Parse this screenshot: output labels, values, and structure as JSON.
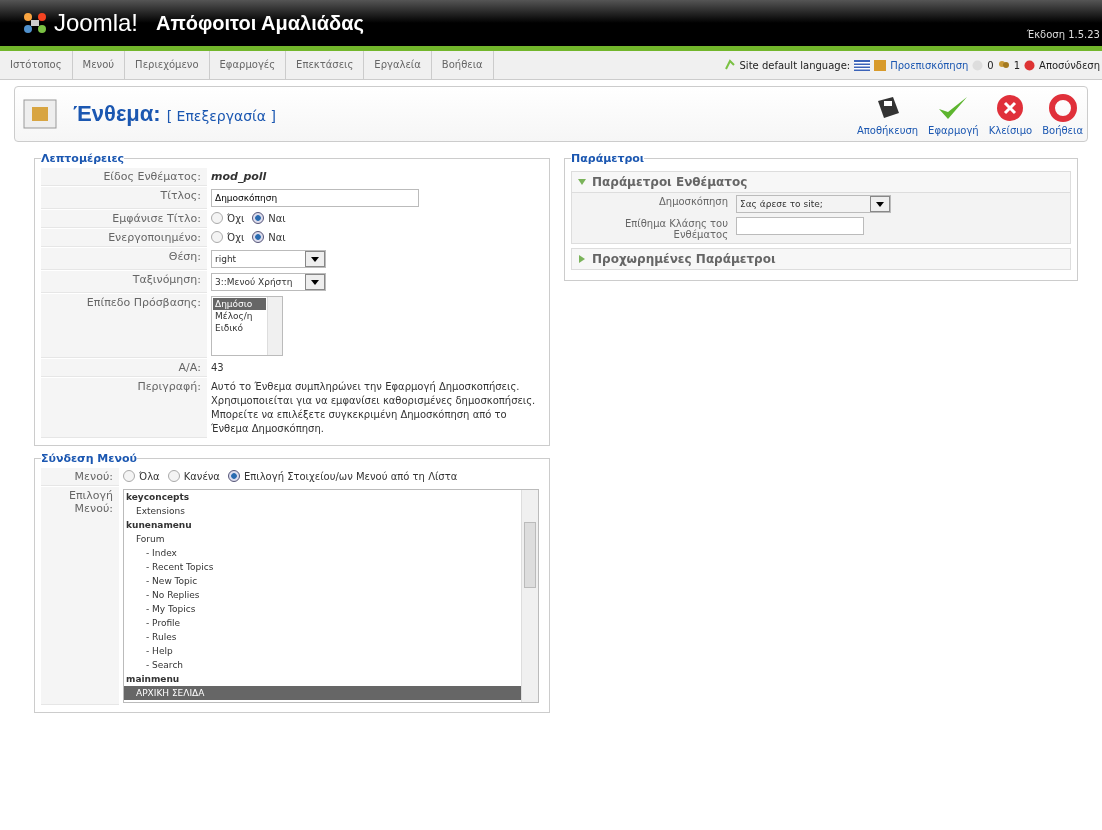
{
  "header": {
    "logo_text": "Joomla!",
    "site_name": "Απόφοιτοι Αμαλιάδας",
    "version": "Έκδοση 1.5.23"
  },
  "nav": {
    "items": [
      "Ιστότοπος",
      "Μενού",
      "Περιεχόμενο",
      "Εφαρμογές",
      "Επεκτάσεις",
      "Εργαλεία",
      "Βοήθεια"
    ],
    "language_label": "Site default language:",
    "preview": "Προεπισκόπηση",
    "messages": "0",
    "users": "1",
    "logout": "Αποσύνδεση"
  },
  "toolbar": {
    "title": "Ένθεμα:",
    "subtitle": "[ Επεξεργασία ]",
    "buttons": [
      {
        "kind": "save",
        "label": "Αποθήκευση"
      },
      {
        "kind": "apply",
        "label": "Εφαρμογή"
      },
      {
        "kind": "close",
        "label": "Κλείσιμο"
      },
      {
        "kind": "help",
        "label": "Βοήθεια"
      }
    ]
  },
  "details": {
    "legend": "Λεπτομέρειες",
    "rows": [
      {
        "kind": "static",
        "label": "Είδος Ενθέματος:",
        "value": "mod_poll"
      },
      {
        "kind": "text",
        "label": "Τίτλος:",
        "value": "Δημοσκόπηση"
      },
      {
        "kind": "radio",
        "label": "Εμφάνισε Τίτλο:",
        "options": [
          {
            "label": "Όχι",
            "selected": false
          },
          {
            "label": "Ναι",
            "selected": true
          }
        ]
      },
      {
        "kind": "radio",
        "label": "Ενεργοποιημένο:",
        "options": [
          {
            "label": "Όχι",
            "selected": false
          },
          {
            "label": "Ναι",
            "selected": true
          }
        ]
      },
      {
        "kind": "select",
        "label": "Θέση:",
        "value": "right"
      },
      {
        "kind": "select",
        "label": "Ταξινόμηση:",
        "value": "3::Μενού Χρήστη"
      },
      {
        "kind": "listbox",
        "label": "Επίπεδο Πρόσβασης:",
        "options": [
          {
            "label": "Δημόσιο",
            "selected": true
          },
          {
            "label": "Μέλος/η",
            "selected": false
          },
          {
            "label": "Ειδικό",
            "selected": false
          }
        ]
      },
      {
        "kind": "plain",
        "label": "Α/Α:",
        "value": "43"
      },
      {
        "kind": "plain",
        "label": "Περιγραφή:",
        "value": "Αυτό το Ένθεμα συμπληρώνει την Εφαρμογή Δημοσκοπήσεις. Χρησιμοποιείται για να εμφανίσει καθορισμένες δημοσκοπήσεις. Μπορείτε να επιλέξετε συγκεκριμένη Δημοσκόπηση από το Ένθεμα Δημοσκόπηση."
      }
    ]
  },
  "menu_assignment": {
    "legend": "Σύνδεση Μενού",
    "menus_label": "Μενού:",
    "options": [
      {
        "label": "Όλα",
        "selected": false
      },
      {
        "label": "Κανένα",
        "selected": false
      },
      {
        "label": "Επιλογή Στοιχείου/ων Μενού από τη Λίστα",
        "selected": true
      }
    ],
    "selection_label": "Επιλογή Μενού:",
    "items": [
      {
        "label": "keyconcepts",
        "selected": false,
        "children": [
          {
            "label": "Extensions",
            "selected": false
          }
        ]
      },
      {
        "label": "kunenamenu",
        "selected": false,
        "children": [
          {
            "label": "Forum",
            "selected": false,
            "children": [
              {
                "label": "- Index",
                "selected": false
              },
              {
                "label": "- Recent Topics",
                "selected": false
              },
              {
                "label": "- New Topic",
                "selected": false
              },
              {
                "label": "- No Replies",
                "selected": false
              },
              {
                "label": "- My Topics",
                "selected": false
              },
              {
                "label": "- Profile",
                "selected": false
              },
              {
                "label": "- Rules",
                "selected": false
              },
              {
                "label": "- Help",
                "selected": false
              },
              {
                "label": "- Search",
                "selected": false
              }
            ]
          }
        ]
      },
      {
        "label": "mainmenu",
        "selected": false,
        "children": [
          {
            "label": "ΑΡΧΙΚΗ ΣΕΛΙΔΑ",
            "selected": true
          }
        ]
      }
    ]
  },
  "parameters": {
    "legend": "Παράμετροι",
    "panels": [
      {
        "title": "Παράμετροι Ενθέματος",
        "expanded": true,
        "rows": [
          {
            "kind": "select",
            "label": "Δημοσκόπηση",
            "value": "Σας άρεσε το site;"
          },
          {
            "kind": "text",
            "label": "Επίθημα Κλάσης του Ενθέματος",
            "value": ""
          }
        ]
      },
      {
        "title": "Προχωρημένες Παράμετροι",
        "expanded": false
      }
    ]
  }
}
